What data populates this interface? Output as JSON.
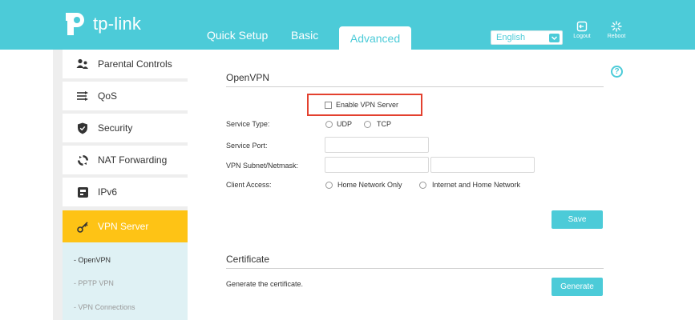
{
  "brand": {
    "name": "tp-link"
  },
  "tabs": [
    {
      "label": "Quick Setup"
    },
    {
      "label": "Basic"
    },
    {
      "label": "Advanced"
    }
  ],
  "language": {
    "selected": "English"
  },
  "tools": {
    "logout": "Logout",
    "reboot": "Reboot"
  },
  "sidebar": {
    "items": [
      {
        "label": "Parental Controls",
        "icon": "parental-controls-icon"
      },
      {
        "label": "QoS",
        "icon": "qos-icon"
      },
      {
        "label": "Security",
        "icon": "shield-icon"
      },
      {
        "label": "NAT Forwarding",
        "icon": "nat-forwarding-icon"
      },
      {
        "label": "IPv6",
        "icon": "ipv6-icon"
      },
      {
        "label": "VPN Server",
        "icon": "key-icon"
      }
    ],
    "subitems": [
      {
        "label": "- OpenVPN"
      },
      {
        "label": "- PPTP VPN"
      },
      {
        "label": "- VPN Connections"
      }
    ]
  },
  "openvpn": {
    "title": "OpenVPN",
    "enable_label": "Enable VPN Server",
    "service_type_label": "Service Type:",
    "service_type_options": [
      "UDP",
      "TCP"
    ],
    "service_port_label": "Service Port:",
    "subnet_label": "VPN Subnet/Netmask:",
    "client_access_label": "Client Access:",
    "client_access_options": [
      "Home Network Only",
      "Internet and Home Network"
    ],
    "save_label": "Save"
  },
  "certificate": {
    "title": "Certificate",
    "description": "Generate the certificate.",
    "generate_label": "Generate"
  },
  "colors": {
    "accent": "#4ccbd8",
    "active_menu": "#fec315",
    "highlight": "#e3412f"
  }
}
